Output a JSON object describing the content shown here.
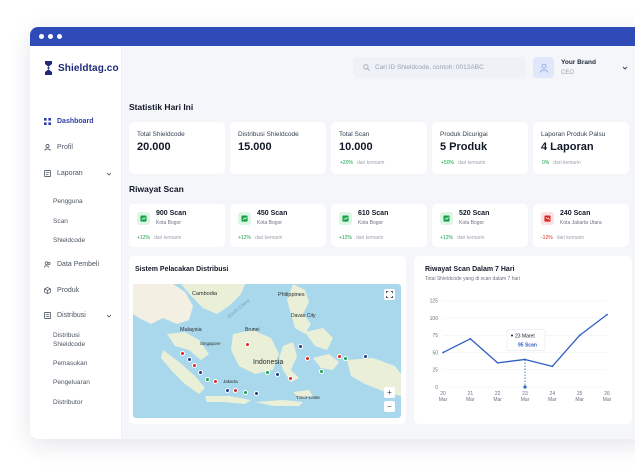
{
  "app": {
    "brand": "Shieldtag.co"
  },
  "sidebar": {
    "items": [
      {
        "label": "Dashboard",
        "icon": "grid-icon",
        "active": true
      },
      {
        "label": "Profil",
        "icon": "user-icon"
      },
      {
        "label": "Laporan",
        "icon": "report-icon",
        "expanded": true,
        "children": [
          "Pengguna",
          "Scan",
          "Shieldcode"
        ]
      },
      {
        "label": "Data Pembeli",
        "icon": "users-icon"
      },
      {
        "label": "Produk",
        "icon": "box-icon"
      },
      {
        "label": "Distribusi",
        "icon": "distribution-icon",
        "expanded": true,
        "children": [
          "Distribusi Shieldcode",
          "Pemasukan",
          "Pengeluaran",
          "Distributor"
        ]
      }
    ]
  },
  "topbar": {
    "search_placeholder": "Cari ID Shieldcode, contoh: 0012ABC",
    "user_name": "Your Brand",
    "user_role": "CEO"
  },
  "stats": {
    "title": "Statistik Hari Ini",
    "delta_suffix": "dari kemarin",
    "cards": [
      {
        "label": "Total Shieldcode",
        "value": "20.000",
        "delta": ""
      },
      {
        "label": "Distribusi Shieldcode",
        "value": "15.000",
        "delta": ""
      },
      {
        "label": "Total Scan",
        "value": "10.000",
        "delta": "+20%"
      },
      {
        "label": "Produk Dicurigai",
        "value": "5 Produk",
        "delta": "+50%"
      },
      {
        "label": "Laporan Produk Palsu",
        "value": "4 Laporan",
        "delta": "0%"
      }
    ]
  },
  "scan_history": {
    "title": "Riwayat Scan",
    "delta_suffix": "dari kemarin",
    "cards": [
      {
        "count": "900 Scan",
        "city": "Kota Bogor",
        "delta": "+12%",
        "trend": "up"
      },
      {
        "count": "450 Scan",
        "city": "Kota Bogor",
        "delta": "+12%",
        "trend": "up"
      },
      {
        "count": "610 Scan",
        "city": "Kota Bogor",
        "delta": "+12%",
        "trend": "up"
      },
      {
        "count": "520 Scan",
        "city": "Kota Bogor",
        "delta": "+12%",
        "trend": "up"
      },
      {
        "count": "240 Scan",
        "city": "Kota Jakarta Utara",
        "delta": "-12%",
        "trend": "down"
      }
    ],
    "colors": {
      "up": "#16a34a",
      "down": "#dc2626"
    }
  },
  "map": {
    "title": "Sistem Pelacakan Distribusi",
    "labels": {
      "cambodia": "Cambodia",
      "philippines": "Philippines",
      "malaysia": "Malaysia",
      "brunei": "Brunei",
      "singapore": "Singapore",
      "davao": "Davao City",
      "indonesia": "Indonesia",
      "jakarta": "Jakarta",
      "timor": "Timor-Leste",
      "sea": "South China"
    },
    "zoom_in": "+",
    "zoom_out": "−",
    "marker_colors": [
      "#1e3a8a",
      "#dc2626",
      "#16a34a"
    ]
  },
  "chart_data": {
    "type": "line",
    "title": "Riwayat Scan Dalam 7 Hari",
    "subtitle": "Total Shieldcode yang di scan dalam 7 hari",
    "categories": [
      "20",
      "21",
      "22",
      "23",
      "24",
      "25",
      "26"
    ],
    "category_sublabel": "Mar",
    "y_ticks": [
      "0",
      "25",
      "50",
      "75",
      "100",
      "125"
    ],
    "ylim": [
      0,
      135
    ],
    "values": [
      50,
      70,
      35,
      40,
      30,
      75,
      105
    ],
    "series_color": "#2f5fc4",
    "tooltip": {
      "index": 3,
      "date": "23 Maret",
      "value": "95 Scan"
    }
  }
}
